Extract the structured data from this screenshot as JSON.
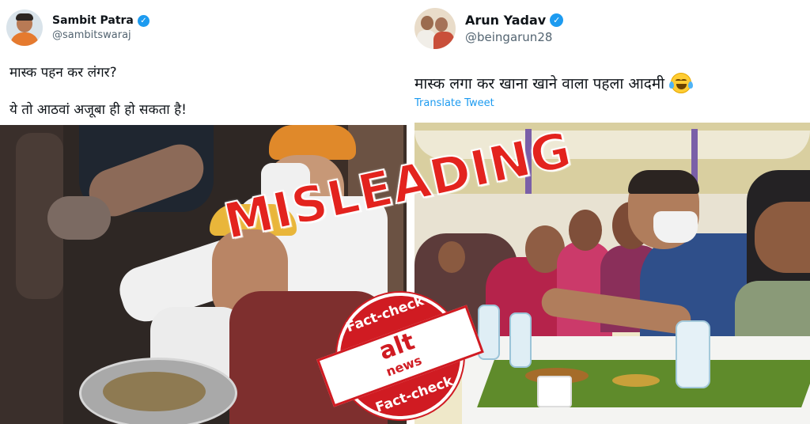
{
  "left_tweet": {
    "display_name": "Sambit Patra",
    "handle": "@sambitswaraj",
    "verified_mark": "✓",
    "text_line1": "मास्क पहन कर लंगर?",
    "text_line2": "ये तो आठवां अजूबा ही हो सकता है!"
  },
  "right_tweet": {
    "display_name": "Arun Yadav",
    "handle": "@beingarun28",
    "verified_mark": "✓",
    "text": "मास्क लगा कर खाना खाने वाला पहला आदमी",
    "emoji": "face-with-tears-of-joy-icon",
    "translate_label": "Translate Tweet"
  },
  "overlay": {
    "verdict": "MISLEADING",
    "stamp_top": "Fact-check",
    "stamp_brand_alt": "alt",
    "stamp_brand_news": "news",
    "stamp_bottom": "Fact-check"
  },
  "colors": {
    "verified_blue": "#1d9bf0",
    "link_blue": "#1d9bf0",
    "verdict_red": "#e3231e",
    "stamp_red": "#d01b22",
    "handle_gray": "#536471"
  }
}
